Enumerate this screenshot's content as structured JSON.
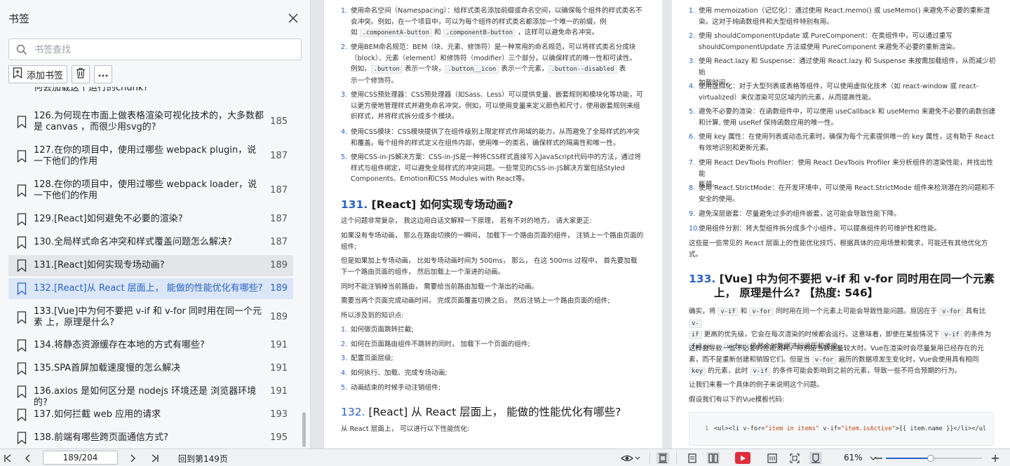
{
  "sidebar": {
    "title": "书签",
    "search_placeholder": "书签查找",
    "add_label": "添加书签",
    "partial_item": "何去加载这个运行的chunk?",
    "items": [
      {
        "text": "126.为何现在市面上做表格渲染可视化技术的，大多数都是 canvas ，而很少用svg的?",
        "page": "185"
      },
      {
        "text": "127.在你的项目中，使用过哪些 webpack plugin，说一下他们的作用",
        "page": "187"
      },
      {
        "text": "128.在你的项目中，使用过哪些 webpack loader，说一下他们的作用",
        "page": "187"
      },
      {
        "text": "129.[React]如何避免不必要的渲染?",
        "page": "187"
      },
      {
        "text": "130.全局样式命名冲突和样式覆盖问题怎么解决?",
        "page": "187"
      },
      {
        "text": "131.[React]如何实现专场动画?",
        "page": "189"
      },
      {
        "text": "132.[React]从 React 层面上， 能做的性能优化有哪些?",
        "page": "189"
      },
      {
        "text": "133.[Vue]中为何不要把 v-if 和 v-for 同时用在同一个元素 上，原理是什么?",
        "page": "189"
      },
      {
        "text": "134.将静态资源缓存在本地的方式有哪些?",
        "page": "191"
      },
      {
        "text": "135.SPA首屏加载速度慢的怎么解决",
        "page": "191"
      },
      {
        "text": "136.axios 是如何区分是 nodejs 环境还是 浏览器环境的?",
        "page": "191"
      },
      {
        "text": "137.如何拦截 web 应用的请求",
        "page": "193"
      },
      {
        "text": "138.前端有哪些跨页面通信方式?",
        "page": "195"
      }
    ]
  },
  "left_page": {
    "list1": [
      {
        "n": "1.",
        "l1": "使用命名空间（Namespacing）：给样式类名添加前缀或命名空间，以确保每个组件的样式类名不",
        "l2": "会冲突。例如，在一个项目中，可以为每个组件的样式类名都添加一个唯一的前缀，例",
        "l3a": "如 ",
        "c1": ".componentA-button",
        "l3b": " 和 ",
        "c2": ".componentB-button",
        "l3c": " ，这样可以避免命名冲突。"
      },
      {
        "n": "2.",
        "l1": "使用BEM命名规范：BEM（块、元素、修饰符）是一种常用的命名规范，可以将样式类名分成块",
        "l2": "（block）、元素（element）和修饰符（modifier）三个部分，以确保样式的唯一性和可读性。",
        "l3a": "例如，",
        "c1": ".button",
        "l3b": " 表示一个块，",
        "c2": ".button__icon",
        "l3c": " 表示一个元素，",
        "c3": ".button--disabled",
        "l3d": " 表",
        "l4": "示一个修饰符。"
      },
      {
        "n": "3.",
        "l1": "使用CSS预处理器：CSS预处理器（如Sass、Less）可以提供变量、嵌套规则和模块化等功能，可",
        "l2": "以更方便地管理样式并避免命名冲突。例如，可以使用变量来定义颜色和尺寸，使用嵌套规则来组",
        "l3": "织样式，并将样式拆分成多个模块。"
      },
      {
        "n": "4.",
        "l1": "使用CSS模块：CSS模块提供了在组件级别上限定样式作用域的能力，从而避免了全局样式的冲突",
        "l2": "和覆盖。每个组件的样式定义在组件内部，使用唯一的类名，确保样式的隔离性和唯一性。"
      },
      {
        "n": "5.",
        "l1": "使用CSS-in-JS解决方案：CSS-in-JS是一种将CSS样式直接写入JavaScript代码中的方法，通过将",
        "l2": "样式与组件绑定，可以避免全局样式的冲突问题。一些常见的CSS-in-JS解决方案包括Styled",
        "l3": "Components、Emotion和CSS Modules with React等。"
      }
    ],
    "h131_num": "131.",
    "h131_text": "[React] 如何实现专场动画?",
    "p131": [
      "这个问题非常复杂， 我这边用白话文解释一下原理， 若有不对的地方， 请大家更正:",
      "如果没有专场动画， 那么在路由切换的一瞬间， 加载下一个路由页面的组件， 注销上一个路由页面的",
      "组件;",
      "但是如果加上专场动画， 比如专场动画时间为 500ms， 那么， 在这 500ms 过程中， 首先要加载",
      "下一个路由页面的组件， 然后加载上一个渐进的动画。",
      "同时不能注销掉当前路由， 需要给当前路由加载一个渐出的动画。",
      "需要当两个页面完成动画时间， 完成页面覆盖切换之后， 然后注销上一个路由页面的组件;",
      "所以涉及到的知识点:"
    ],
    "list131": [
      "如何做页面跳转拦截;",
      "如何在页面路由组件不跳转的同时， 加载下一个页面的组件;",
      "配置页面层级;",
      "如何执行、加载、完成专场动画;",
      "动画结束的时候手动注销组件;"
    ],
    "h132_num": "132.",
    "h132_text": "[React] 从 React 层面上， 能做的性能优化有哪些?",
    "p132": "从 React 层面上， 可以进行以下性能优化:"
  },
  "right_page": {
    "list": [
      {
        "n": "1.",
        "lines": [
          "使用 memoization（记忆化）：通过使用 React.memo() 或 useMemo() 来避免不必要的重新渲",
          "染。这对于纯函数组件和大型组件特别有用。"
        ]
      },
      {
        "n": "2.",
        "lines": [
          "使用 shouldComponentUpdate 或 PureComponent：在类组件中，可以通过重写",
          "shouldComponentUpdate 方法或使用 PureComponent 来避免不必要的重新渲染。"
        ]
      },
      {
        "n": "3.",
        "lines": [
          "使用 React.lazy 和 Suspense：通过使用 React.lazy 和 Suspense 来按需加载组件，从而减少初始",
          "加载时间。"
        ]
      },
      {
        "n": "4.",
        "lines": [
          "使用虚拟化：对于大型列表或表格等组件，可以使用虚拟化技术（如 react-window 或 react-",
          "virtualized）来仅渲染可见区域内的元素，从而提高性能。"
        ]
      },
      {
        "n": "5.",
        "lines": [
          "避免不必要的渲染：在函数组件中，可以使用 useCallback 和 useMemo 来避免不必要的函数创建",
          "和计算, 使用 useRef 保持函数应用的唯一性。"
        ]
      },
      {
        "n": "6.",
        "lines": [
          "使用 key 属性：在使用列表或动态元素时，确保为每个元素提供唯一的 key 属性，这有助于 React",
          "有效地识别和更新元素。"
        ]
      },
      {
        "n": "7.",
        "lines": [
          "使用 React DevTools Profiler：使用 React DevTools Profiler 来分析组件的渲染性能，并找出性能",
          "瓶颈。"
        ]
      },
      {
        "n": "8.",
        "lines": [
          "使用 React.StrictMode：在开发环境中，可以使用 React.StrictMode 组件来检测潜在的问题和不",
          "安全的使用。"
        ]
      },
      {
        "n": "9.",
        "lines": [
          "避免深层嵌套：尽量避免过多的组件嵌套，这可能会导致性能下降。"
        ]
      },
      {
        "n": "10.",
        "lines": [
          "使用组件分割：将大型组件拆分成多个小组件，可以提高组件的可维护性和性能。"
        ]
      }
    ],
    "summary": [
      "这些是一些常见的 React 层面上的性能优化技巧，根据具体的应用场景和需求，可能还有其他优化方",
      "式。"
    ],
    "h133_num": "133.",
    "h133_line1": "[Vue] 中为何不要把 v-if 和 v-for 同时用在同一个元素",
    "h133_line2a": "上， 原理是什么? ",
    "h133_heat": "【热度: 546】",
    "p1_a": "确实，将 ",
    "p1_c1": "v-if",
    "p1_b": " 和 ",
    "p1_c2": "v-for",
    "p1_c": " 同时用在同一个元素上可能会导致性能问题。原因在于 ",
    "p1_c3": "v-for",
    "p1_d": " 具有比 ",
    "p1_c4": "v-",
    "p1_l2_c": "if",
    "p1_l2": " 更高的优先级，它会在每次渲染的时候都会运行。这意味着，即使在某些情况下 ",
    "p1_l2_c2": "v-if",
    "p1_l2b": " 的条件为",
    "p1_l3_c": "false",
    "p1_l3a": " ， ",
    "p1_l3_c2": "v-for",
    "p1_l3b": " 仍然会对数据进行遍历和渲染。",
    "p2_l1": "这样会导致一些不必要的性能消耗，特别是当数据量较大时。Vue在渲染时会尽量复用已经存在的元",
    "p2_l2a": "素，而不是重新创建和销毁它们。但是当 ",
    "p2_l2_c": "v-for",
    "p2_l2b": " 遍历的数据项发生变化时，Vue会使用具有相同",
    "p2_l3_c": "key",
    "p2_l3a": " 的元素，此时 ",
    "p2_l3_c2": "v-if",
    "p2_l3b": " 的条件可能会影响到之前的元素，导致一些不符合预期的行为。",
    "p3": "让我们来看一个具体的例子来说明这个问题。",
    "p4": "假设我们有以下的Vue模板代码:",
    "code_ln": "1",
    "code_a": "<ul><li v-for=",
    "code_s1": "\"item in items\"",
    "code_b": " v-if=",
    "code_s2": "\"item.isActive\"",
    "code_c": ">{{ item.name }}</li></ul"
  },
  "bottombar": {
    "page_value": "189/204",
    "back_link": "回到第149页",
    "zoom": "61%",
    "zoom_fraction": 0.47
  }
}
